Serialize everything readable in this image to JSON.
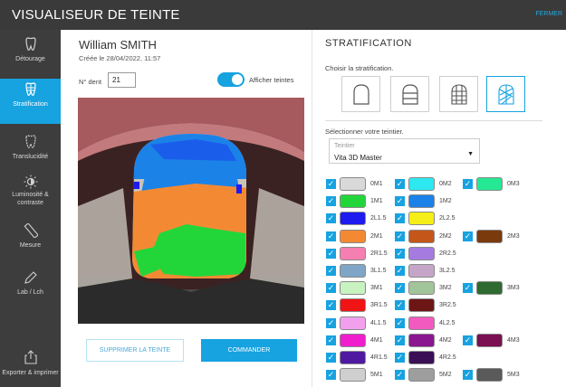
{
  "header": {
    "title": "VISUALISEUR DE TEINTE",
    "close_label": "FERMER"
  },
  "sidebar": {
    "items": [
      {
        "label": "Détourage",
        "icon": "tooth-outline-icon"
      },
      {
        "label": "Stratification",
        "icon": "layers-tooth-icon"
      },
      {
        "label": "Translucidité",
        "icon": "tooth-translucent-icon"
      },
      {
        "label": "Luminosité & contraste",
        "icon": "brightness-icon"
      },
      {
        "label": "Mesure",
        "icon": "ruler-icon"
      },
      {
        "label": "Lab / Lch",
        "icon": "pen-icon"
      },
      {
        "label": "Exporter & imprimer",
        "icon": "export-icon"
      }
    ]
  },
  "patient": {
    "name": "William SMITH",
    "created": "Créée le 28/04/2022, 11:57"
  },
  "tooth": {
    "label": "N° dent",
    "value": "21"
  },
  "show_shades": {
    "label": "Afficher teintes",
    "on": true
  },
  "buttons": {
    "delete": "SUPPRIMER LA TEINTE",
    "order": "COMMANDER"
  },
  "stratification": {
    "title": "STRATIFICATION",
    "choose_label": "Choisir la stratification.",
    "options": [
      "strat-1-icon",
      "strat-2-icon",
      "strat-3-icon",
      "strat-4-icon"
    ],
    "selected_index": 3
  },
  "shade_guide": {
    "label": "Sélectionner votre teintier.",
    "placeholder": "Teintier",
    "value": "Vita 3D Master"
  },
  "shades": [
    [
      {
        "name": "0M1",
        "color": "#d9d9d9"
      },
      {
        "name": "0M2",
        "color": "#2ee8f0"
      },
      {
        "name": "0M3",
        "color": "#25e892"
      }
    ],
    [
      {
        "name": "1M1",
        "color": "#22d63a"
      },
      {
        "name": "1M2",
        "color": "#1b82e8"
      }
    ],
    [
      {
        "name": "2L1.5",
        "color": "#1d1bf0"
      },
      {
        "name": "2L2.5",
        "color": "#f5ee18"
      }
    ],
    [
      {
        "name": "2M1",
        "color": "#f38a33"
      },
      {
        "name": "2M2",
        "color": "#c4561a"
      },
      {
        "name": "2M3",
        "color": "#7a3a0c"
      }
    ],
    [
      {
        "name": "2R1.5",
        "color": "#f57fb0"
      },
      {
        "name": "2R2.5",
        "color": "#a57be0"
      }
    ],
    [
      {
        "name": "3L1.5",
        "color": "#7fa6c6"
      },
      {
        "name": "3L2.5",
        "color": "#c6a6c8"
      }
    ],
    [
      {
        "name": "3M1",
        "color": "#c8f2c0"
      },
      {
        "name": "3M2",
        "color": "#a2c49a"
      },
      {
        "name": "3M3",
        "color": "#2f6a30"
      }
    ],
    [
      {
        "name": "3R1.5",
        "color": "#f01414"
      },
      {
        "name": "3R2.5",
        "color": "#6e1616"
      }
    ],
    [
      {
        "name": "4L1.5",
        "color": "#f2a0ee"
      },
      {
        "name": "4L2.5",
        "color": "#f25ac0"
      }
    ],
    [
      {
        "name": "4M1",
        "color": "#f01ecd"
      },
      {
        "name": "4M2",
        "color": "#8a1690"
      },
      {
        "name": "4M3",
        "color": "#7a0f52"
      }
    ],
    [
      {
        "name": "4R1.5",
        "color": "#4f1aa0"
      },
      {
        "name": "4R2.5",
        "color": "#3a0f55"
      }
    ],
    [
      {
        "name": "5M1",
        "color": "#cfcfcf"
      },
      {
        "name": "5M2",
        "color": "#9e9e9e"
      },
      {
        "name": "5M3",
        "color": "#5a5a5a"
      }
    ]
  ]
}
